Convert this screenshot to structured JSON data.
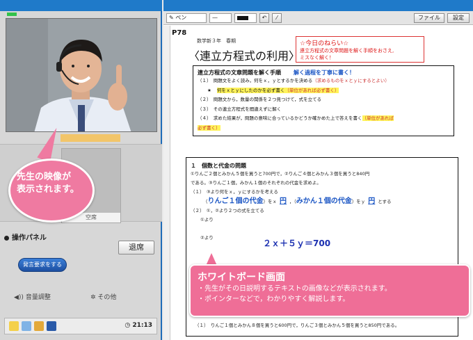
{
  "left": {
    "seat_label": "空席",
    "panel_title": "操作パネル",
    "leave_button": "退席",
    "request_button": "発言要求をする",
    "volume_label": "音量調整",
    "other_label": "その他",
    "clock": "21:13"
  },
  "video_callout": {
    "line1": "先生の映像が",
    "line2": "表示されます。"
  },
  "toolbar": {
    "pen_label": "ペン",
    "file_button": "ファイル",
    "settings_button": "設定"
  },
  "doc": {
    "page": "P78",
    "subtitle": "数学新３年　春期",
    "heading": "〈連立方程式の利用〉",
    "aim_title": "☆今日のねらい☆",
    "aim_line1": "連立方程式の文章問題を解く手順をおさえ,",
    "aim_line2": "ミスなく解く！",
    "steps_title": "連立方程式の文章問題を解く手順",
    "steps_note": "解く過程を丁寧に書く！",
    "step1": "（１）　問題文をよく読み，何をｘ，ｙとするかを決める",
    "step1_note": "（求めるものをｘとｙにするとよい）",
    "step1b_mark": "★",
    "step1b": "何をｘとｙにしたのかを必ず書く",
    "step1b_note": "（単位があれば必ず書く）",
    "step2": "（２）　問題文から，数量の関係を２つ見つけて，式を立てる",
    "step3": "（３）　その連立方程式を間違えずに解く",
    "step4": "（４）　求めた結果が，問題の意味に合っているかどうか確かめた上で答えを書く",
    "step4_note": "（単位があれば",
    "step4_note2": "必ず書く）",
    "prob_title": "１　個数と代金の問題",
    "prob_line1": "①りんご２個とみかん５個を買うと700円で，②りんご４個とみかん３個を買うと840円",
    "prob_line2": "である。③りんご１個，みかん１個のそれぞれの代金を求めよ。",
    "prob_line3": "（１）　③より何をｘ，ｙにするかを考える",
    "apple_label": "りんご１個の代金",
    "mikan_label": "みかん１個の代金",
    "yen": "円",
    "prob_line4_a": "（",
    "prob_line4_b": "）をｘ",
    "prob_line4_c": "，（",
    "prob_line4_d": "）をｙ",
    "prob_line4_e": "とする",
    "prob_line5": "（２）　①，②より２つの式を立てる",
    "from1": "①より",
    "equation": "２ｘ＋５ｙ＝700",
    "from2": "②より",
    "bottom_line": "（１）　りんご１個とみかん８個を買うと600円で，りんご３個とみかん５個を買うと850円である。"
  },
  "wb_callout": {
    "title": "ホワイトボード画面",
    "line1": "・先生がその日説明するテキストの画像などが表示されます。",
    "line2": "・ポインターなどで，わかりやすく解説します。"
  }
}
